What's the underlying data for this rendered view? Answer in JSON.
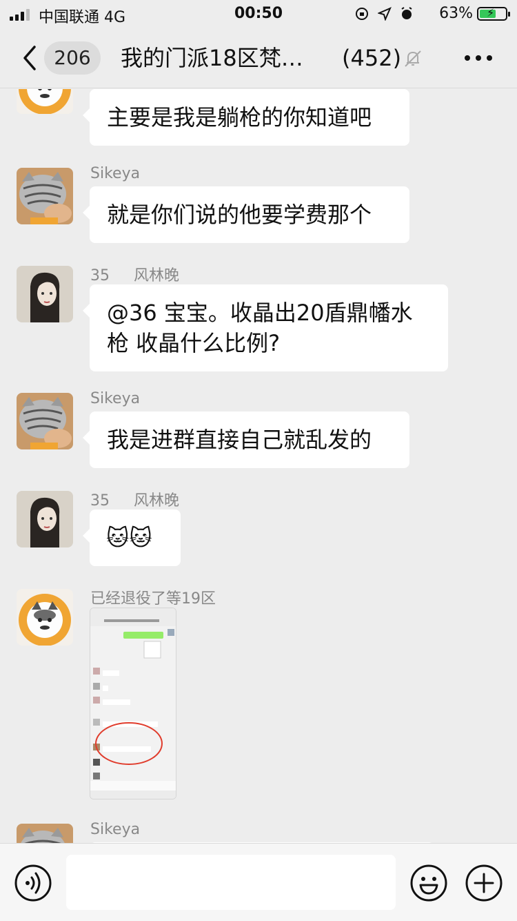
{
  "status_bar": {
    "carrier": "中国联通  4G",
    "time": "00:50",
    "battery": "63%",
    "battery_level": 0.63
  },
  "nav": {
    "unread_count": "206",
    "title": "我的门派18区梵…",
    "member_count": "(452)"
  },
  "messages": [
    {
      "sender": "",
      "avatar": "cat-flower-avatar",
      "text": "主要是我是躺枪的你知道吧"
    },
    {
      "sender": "Sikeya",
      "avatar": "tabby-cat-avatar",
      "text": "就是你们说的他要学费那个"
    },
    {
      "sender": "35     风林晚",
      "avatar": "girl-avatar",
      "text": "@36 宝宝。收晶出20盾鼎幡水枪 收晶什么比例?"
    },
    {
      "sender": "Sikeya",
      "avatar": "tabby-cat-avatar",
      "text": "我是进群直接自己就乱发的"
    },
    {
      "sender": "35     风林晚",
      "avatar": "girl-avatar",
      "text": "🐱🐱"
    },
    {
      "sender": "已经退役了等19区",
      "avatar": "cat-flower-avatar",
      "image": "chat-screenshot-image"
    },
    {
      "sender": "Sikeya",
      "avatar": "tabby-cat-avatar"
    }
  ],
  "colors": {
    "background": "#ededed",
    "bubble": "#ffffff",
    "sender_text": "#888888",
    "battery_green": "#35c759"
  },
  "icons": [
    "back-icon",
    "mute-bell-icon",
    "more-icon",
    "voice-icon",
    "emoji-icon",
    "plus-icon"
  ]
}
